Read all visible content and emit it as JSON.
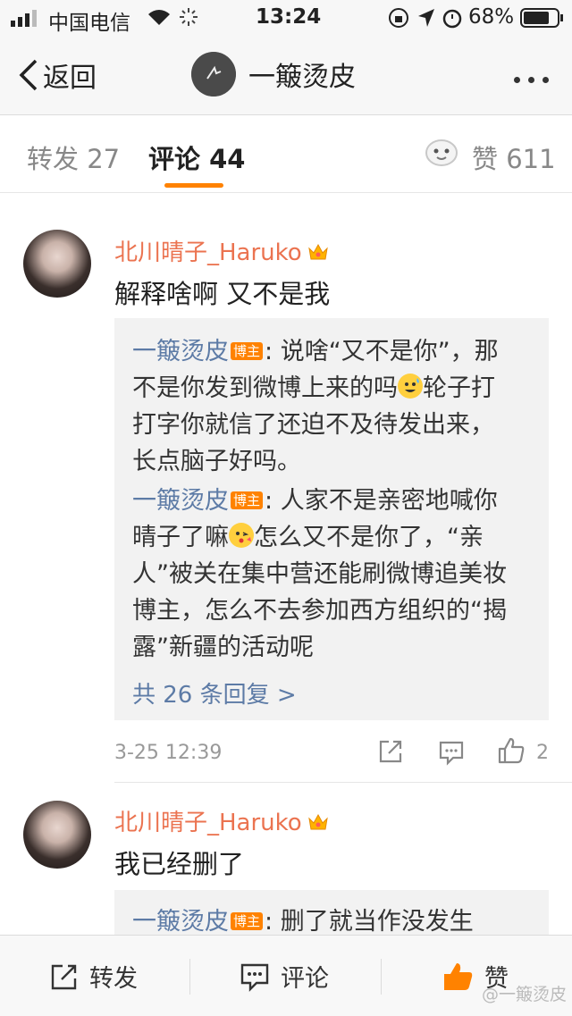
{
  "status_bar": {
    "carrier": "中国电信",
    "time": "13:24",
    "battery": "68%"
  },
  "nav": {
    "back_label": "返回",
    "title": "一簸烫皮"
  },
  "tabs": [
    {
      "label": "转发",
      "count": "27"
    },
    {
      "label": "评论",
      "count": "44"
    },
    {
      "label": "赞",
      "count": "611"
    }
  ],
  "comments": [
    {
      "user": "北川晴子_Haruko",
      "text": "解释啥啊 又不是我",
      "replies": [
        {
          "name": "一簸烫皮",
          "badge": "博主",
          "lines": [
            ": 说啥“又不是你”，那",
            "不是你发到微博上来的吗",
            "轮子打",
            "打字你就信了还迫不及待发出来，",
            "长点脑子好吗。"
          ]
        },
        {
          "name": "一簸烫皮",
          "badge": "博主",
          "lines": [
            ": 人家不是亲密地喊你",
            "晴子了嘛",
            "怎么又不是你了，“亲",
            "人”被关在集中营还能刷微博追美妆",
            "博主，怎么不去参加西方组织的“揭",
            "露”新疆的活动呢"
          ]
        }
      ],
      "more_replies": "共 26 条回复 >",
      "time": "3-25 12:39",
      "likes": "2"
    },
    {
      "user": "北川晴子_Haruko",
      "text": "我已经删了",
      "replies": [
        {
          "name": "一簸烫皮",
          "badge": "博主",
          "lines": [
            ": 删了就当作没发生"
          ]
        }
      ]
    }
  ],
  "bottom_bar": {
    "repost": "转发",
    "comment": "评论",
    "like": "赞"
  },
  "watermark": "@一簸烫皮",
  "colors": {
    "accent": "#ff8200",
    "username": "#eb7350",
    "reply_name": "#5d7ba6"
  }
}
